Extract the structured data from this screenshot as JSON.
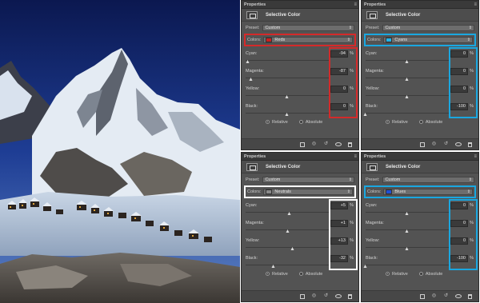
{
  "panels": [
    {
      "id": "tl",
      "title": "Properties",
      "adjustment": "Selective Color",
      "preset_label": "Preset:",
      "preset_value": "Custom",
      "colors_label": "Colors:",
      "colors_value": "Reds",
      "swatch": "#cc1f1f",
      "highlight": "#d42a2a",
      "sliders": [
        {
          "label": "Cyan:",
          "value": "-94",
          "unit": "%",
          "level": 0.03
        },
        {
          "label": "Magenta:",
          "value": "-87",
          "unit": "%",
          "level": 0.065
        },
        {
          "label": "Yellow:",
          "value": "0",
          "unit": "%",
          "level": 0.5
        },
        {
          "label": "Black:",
          "value": "0",
          "unit": "%",
          "level": 0.5
        }
      ],
      "method_relative": "Relative",
      "method_absolute": "Absolute"
    },
    {
      "id": "tr",
      "title": "Properties",
      "adjustment": "Selective Color",
      "preset_label": "Preset:",
      "preset_value": "Custom",
      "colors_label": "Colors:",
      "colors_value": "Cyans",
      "swatch": "#22b3e8",
      "highlight": "#1aa7e0",
      "sliders": [
        {
          "label": "Cyan:",
          "value": "0",
          "unit": "%",
          "level": 0.5
        },
        {
          "label": "Magenta:",
          "value": "0",
          "unit": "%",
          "level": 0.5
        },
        {
          "label": "Yellow:",
          "value": "0",
          "unit": "%",
          "level": 0.5
        },
        {
          "label": "Black:",
          "value": "-100",
          "unit": "%",
          "level": 0.0
        }
      ],
      "method_relative": "Relative",
      "method_absolute": "Absolute"
    },
    {
      "id": "bl",
      "title": "Properties",
      "adjustment": "Selective Color",
      "preset_label": "Preset:",
      "preset_value": "Custom",
      "colors_label": "Colors:",
      "colors_value": "Neutrals",
      "swatch": "#8a8a8a",
      "highlight": "#ffffff",
      "sliders": [
        {
          "label": "Cyan:",
          "value": "+5",
          "unit": "%",
          "level": 0.525
        },
        {
          "label": "Magenta:",
          "value": "+1",
          "unit": "%",
          "level": 0.505
        },
        {
          "label": "Yellow:",
          "value": "+13",
          "unit": "%",
          "level": 0.565
        },
        {
          "label": "Black:",
          "value": "-32",
          "unit": "%",
          "level": 0.34
        }
      ],
      "method_relative": "Relative",
      "method_absolute": "Absolute"
    },
    {
      "id": "br",
      "title": "Properties",
      "adjustment": "Selective Color",
      "preset_label": "Preset:",
      "preset_value": "Custom",
      "colors_label": "Colors:",
      "colors_value": "Blues",
      "swatch": "#1f4fd6",
      "highlight": "#1aa7e0",
      "sliders": [
        {
          "label": "Cyan:",
          "value": "0",
          "unit": "%",
          "level": 0.5
        },
        {
          "label": "Magenta:",
          "value": "0",
          "unit": "%",
          "level": 0.5
        },
        {
          "label": "Yellow:",
          "value": "0",
          "unit": "%",
          "level": 0.5
        },
        {
          "label": "Black:",
          "value": "-100",
          "unit": "%",
          "level": 0.0
        }
      ],
      "method_relative": "Relative",
      "method_absolute": "Absolute"
    }
  ],
  "icons": {
    "menu": "panel-menu-icon",
    "clip": "clip-to-layer-icon",
    "view_previous": "view-previous-icon",
    "reset": "reset-icon",
    "visibility": "visibility-eye-icon",
    "delete": "trash-icon"
  }
}
